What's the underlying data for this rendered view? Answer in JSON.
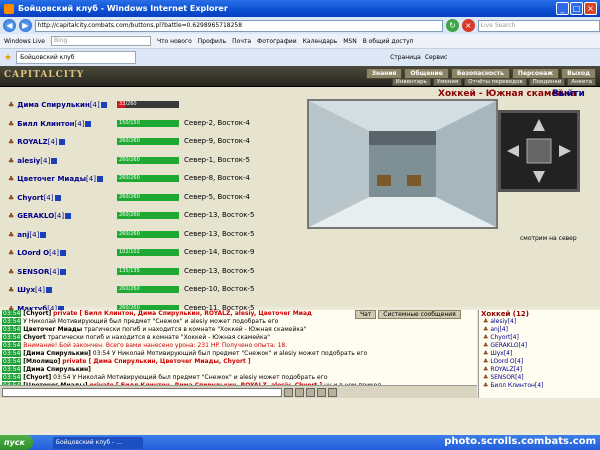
{
  "window": {
    "title": "Бойцовский клуб - Windows Internet Explorer",
    "url": "http://capitalcity.combats.com/buttons.pl?battle=0.6298965718258",
    "search_placeholder": "Live Search"
  },
  "links": {
    "windows_live": "Windows Live",
    "bing": "Bing",
    "items": [
      "Что нового",
      "Профиль",
      "Почта",
      "Фотографии",
      "Календарь",
      "MSN",
      "В общий доступ"
    ]
  },
  "tab": {
    "label": "Бойцовский клуб",
    "page": "Страница",
    "service": "Сервис"
  },
  "game": {
    "logo": "CAPITALCITY",
    "menu1": [
      "Знания",
      "Общение",
      "Безопасность",
      "Персонаж",
      "Выход"
    ],
    "menu2": [
      "Инвентарь",
      "Умения",
      "Отчёты переводов",
      "Поединки",
      "Анкета"
    ]
  },
  "players": [
    {
      "name": "Дима Спирулькин",
      "lvl": "[4]",
      "hp": "33/260",
      "frac": 0.13,
      "red": true,
      "loc": ""
    },
    {
      "name": "Билл Клинтон",
      "lvl": "[4]",
      "hp": "150/150",
      "frac": 1,
      "red": false,
      "loc": "Север-2, Восток-4"
    },
    {
      "name": "ROYALZ",
      "lvl": "[4]",
      "hp": "260/260",
      "frac": 1,
      "red": false,
      "loc": "Север-9, Восток-4"
    },
    {
      "name": "alesiy",
      "lvl": "[4]",
      "hp": "260/260",
      "frac": 1,
      "red": false,
      "loc": "Север-1, Восток-5"
    },
    {
      "name": "Цветочег Миады",
      "lvl": "[4]",
      "hp": "260/260",
      "frac": 1,
      "red": false,
      "loc": "Север-8, Восток-4"
    },
    {
      "name": "Chyort",
      "lvl": "[4]",
      "hp": "260/260",
      "frac": 1,
      "red": false,
      "loc": "Север-5, Восток-4"
    },
    {
      "name": "GERAKLO",
      "lvl": "[4]",
      "hp": "260/260",
      "frac": 1,
      "red": false,
      "loc": "Север-13, Восток-5"
    },
    {
      "name": "anj",
      "lvl": "[4]",
      "hp": "260/260",
      "frac": 1,
      "red": false,
      "loc": "Север-13, Восток-5"
    },
    {
      "name": "LOord O",
      "lvl": "[4]",
      "hp": "102/102",
      "frac": 1,
      "red": false,
      "loc": "Север-14, Восток-9"
    },
    {
      "name": "SENSOR",
      "lvl": "[4]",
      "hp": "135/135",
      "frac": 1,
      "red": false,
      "loc": "Север-13, Восток-5"
    },
    {
      "name": "Шух",
      "lvl": "[4]",
      "hp": "260/260",
      "frac": 1,
      "red": false,
      "loc": "Север-10, Восток-5"
    },
    {
      "name": "Мактуб",
      "lvl": "[4]",
      "hp": "260/260",
      "frac": 1,
      "red": false,
      "loc": "Север-11, Восток-5"
    }
  ],
  "room": {
    "title": "Хоккей - Южная скамейка",
    "exit": "Выйти",
    "watch": "смотрим на север"
  },
  "chat_tabs": [
    "Чат",
    "Системные сообщения"
  ],
  "chat": [
    {
      "ts": "03:54",
      "a": "[Chyort]",
      "p": "private [ Билл Клинтон, Дима Спирулькин, ROYALZ, alesiy, Цветочег Миад",
      "t": ""
    },
    {
      "ts": "03:54",
      "a": "",
      "p": "",
      "t": "У Николай Мотивирующий был предмет \"Снежок\" и alesiy может подобрать его"
    },
    {
      "ts": "03:54",
      "a": "Цветочег Миады",
      "p": "",
      "t": "трагически погиб и находится в комнате \"Хоккей - Южная скамейка\""
    },
    {
      "ts": "03:54",
      "a": "Chyort",
      "p": "",
      "t": "трагически погиб и находится в комнате \"Хоккей - Южная скамейка\""
    },
    {
      "ts": "03:54",
      "a": "",
      "p": "",
      "t": "Внимание! Бой закончен. Всего вами нанесено урона: 231 HP. Получено опыта: 18."
    },
    {
      "ts": "03:54",
      "a": "[Дима Спирулькин]",
      "p": "",
      "t": "03:54 У Николай Мотивирующий был предмет \"Снежок\" и alesiy может подобрать его"
    },
    {
      "ts": "03:54",
      "a": "[Млолицо]",
      "p": "private [ Дима Спирулькин, Цветочег Миады, Chyort ]",
      "t": ""
    },
    {
      "ts": "03:54",
      "a": "[Дима Спирулькин]",
      "p": "",
      "t": ""
    },
    {
      "ts": "03:54",
      "a": "[Chyort]",
      "p": "",
      "t": "03:54 У Николай Мотивирующий был предмет \"Снежок\" и alesiy может подобрать его"
    },
    {
      "ts": "03:54",
      "a": "[Цветочег Миады]",
      "p": "private [ Билл Клинтон, Дима Спирулькин, ROYALZ, alesiy, Chyort ]",
      "t": "ну и в чем прикол"
    },
    {
      "ts": "",
      "a": "",
      "p": "",
      "t": "обьясните, ну завалили и что дальше?)"
    },
    {
      "ts": "03:54",
      "a": "[Дима Спирулькин]",
      "p": "private [ Млолицо, Цветочег Миады, Chyort ]",
      "t": "победили"
    }
  ],
  "right": {
    "header": "Хоккей (12)",
    "items": [
      "alesiy[4]",
      "anj[4]",
      "Chyort[4]",
      "GERAKLO[4]",
      "Шух[4]",
      "LOord O[4]",
      "ROYALZ[4]",
      "SENSOR[4]",
      "Билл Клинтон[4]"
    ]
  },
  "taskbar": {
    "start": "пуск",
    "task": "Бойцовский клуб - ..."
  },
  "watermark": "photo.scrolls.combats.com"
}
